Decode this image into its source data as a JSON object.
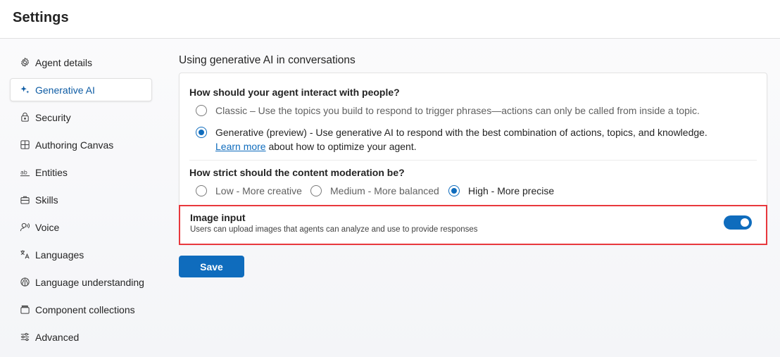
{
  "header": {
    "title": "Settings"
  },
  "sidebar": {
    "items": [
      {
        "label": "Agent details",
        "icon": "gear-icon"
      },
      {
        "label": "Generative AI",
        "icon": "sparkle-icon",
        "active": true
      },
      {
        "label": "Security",
        "icon": "lock-icon"
      },
      {
        "label": "Authoring Canvas",
        "icon": "grid-icon"
      },
      {
        "label": "Entities",
        "icon": "text-ab-icon"
      },
      {
        "label": "Skills",
        "icon": "briefcase-icon"
      },
      {
        "label": "Voice",
        "icon": "voice-icon"
      },
      {
        "label": "Languages",
        "icon": "translate-icon"
      },
      {
        "label": "Language understanding",
        "icon": "brain-icon"
      },
      {
        "label": "Component collections",
        "icon": "collection-icon"
      },
      {
        "label": "Advanced",
        "icon": "sliders-icon"
      }
    ]
  },
  "main": {
    "title": "Using generative AI in conversations",
    "interaction": {
      "question": "How should your agent interact with people?",
      "classic_label": "Classic – Use the topics you build to respond to trigger phrases—actions can only be called from inside a topic.",
      "generative_label": "Generative (preview) - Use generative AI to respond with the best combination of actions, topics, and knowledge.",
      "learn_more_link": "Learn more",
      "learn_more_suffix": " about how to optimize your agent.",
      "selected": "generative"
    },
    "moderation": {
      "question": "How strict should the content moderation be?",
      "options": [
        "Low - More creative",
        "Medium - More balanced",
        "High - More precise"
      ],
      "selected": "High - More precise"
    },
    "image_input": {
      "title": "Image input",
      "description": "Users can upload images that agents can analyze and use to provide responses",
      "enabled": true
    },
    "save_label": "Save"
  },
  "colors": {
    "accent": "#0f6cbd",
    "highlight_border": "#e8383d"
  }
}
